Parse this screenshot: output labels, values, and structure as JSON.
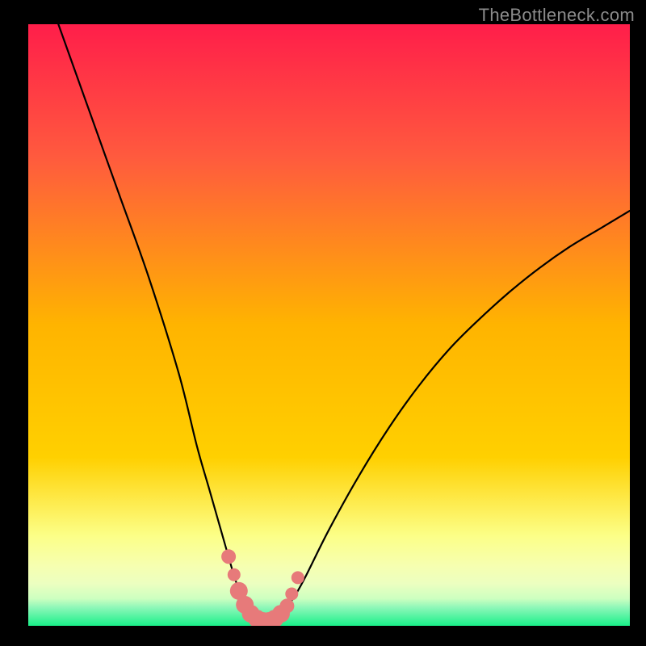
{
  "attribution": "TheBottleneck.com",
  "colors": {
    "bg": "#000000",
    "grad_top": "#ff1e4a",
    "grad_upper": "#ff6a3a",
    "grad_mid": "#ffd000",
    "grad_lower": "#fff57b",
    "grad_band": "#faffad",
    "grad_green": "#19f089",
    "curve": "#000000",
    "marker_fill": "#e77a7a",
    "marker_stroke": "#c94f56"
  },
  "chart_data": {
    "type": "line",
    "title": "",
    "xlabel": "",
    "ylabel": "",
    "xlim": [
      0,
      100
    ],
    "ylim": [
      0,
      100
    ],
    "series": [
      {
        "name": "bottleneck-curve",
        "x": [
          5,
          10,
          15,
          20,
          25,
          28,
          30,
          32,
          34,
          35,
          36,
          37,
          38,
          39,
          40,
          41,
          42,
          44,
          46,
          50,
          55,
          60,
          65,
          70,
          75,
          80,
          85,
          90,
          95,
          100
        ],
        "y": [
          100,
          86,
          72,
          58,
          42,
          30,
          23,
          16,
          9,
          6,
          3.5,
          2,
          1.2,
          0.8,
          0.8,
          1.2,
          2,
          4.5,
          8,
          16,
          25,
          33,
          40,
          46,
          51,
          55.5,
          59.5,
          63,
          66,
          69
        ]
      }
    ],
    "markers": {
      "name": "highlight-points",
      "x": [
        33.3,
        34.2,
        35.0,
        36.0,
        37.0,
        38.0,
        39.0,
        40.0,
        41.0,
        42.0,
        43.0,
        43.8,
        44.8
      ],
      "y": [
        11.5,
        8.5,
        5.8,
        3.5,
        2.0,
        1.2,
        0.8,
        0.8,
        1.2,
        2.0,
        3.3,
        5.3,
        8.0
      ],
      "r": [
        9,
        8,
        11,
        11,
        11,
        11,
        11,
        11,
        11,
        11,
        9,
        8,
        8
      ]
    }
  }
}
